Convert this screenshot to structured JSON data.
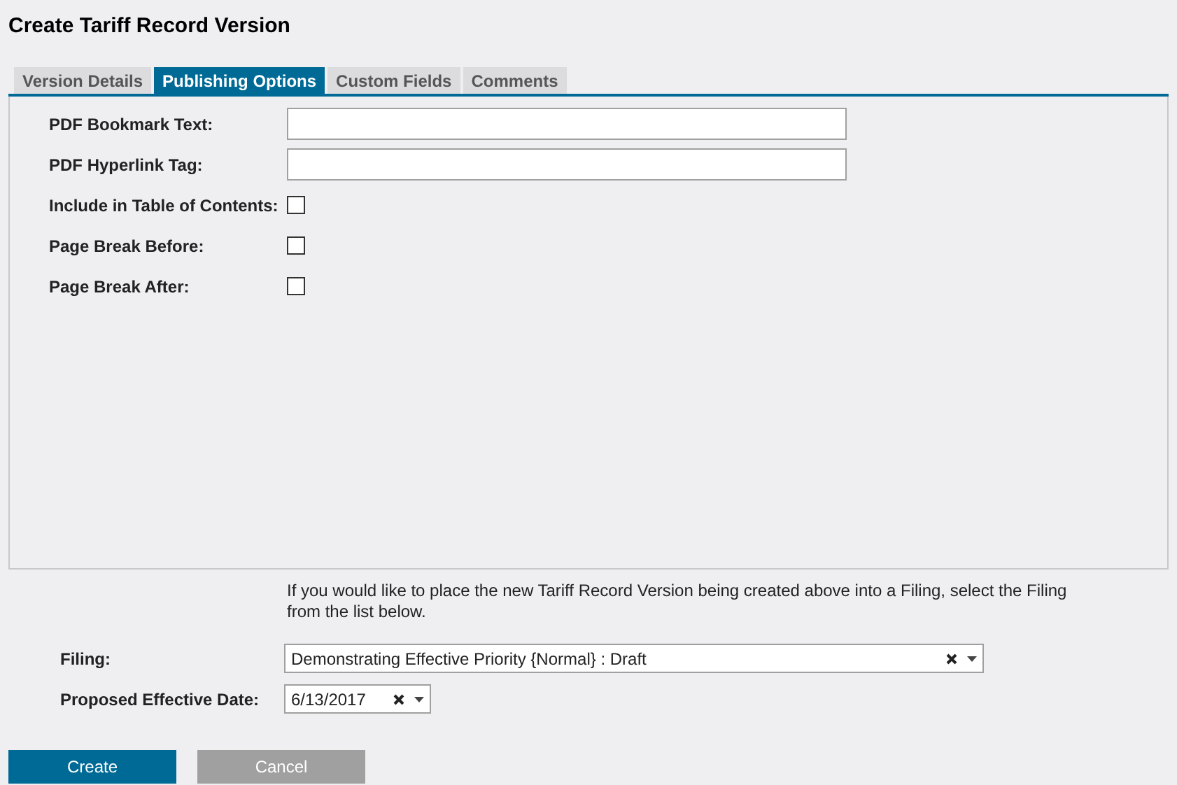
{
  "title": "Create Tariff Record Version",
  "tabs": [
    {
      "label": "Version Details",
      "selected": false
    },
    {
      "label": "Publishing Options",
      "selected": true
    },
    {
      "label": "Custom Fields",
      "selected": false
    },
    {
      "label": "Comments",
      "selected": false
    }
  ],
  "fields": [
    {
      "kind": "text",
      "label": "PDF Bookmark Text:"
    },
    {
      "kind": "text",
      "label": "PDF Hyperlink Tag:"
    },
    {
      "kind": "checkbox",
      "label": "Include in Table of Contents:",
      "checked": false
    },
    {
      "kind": "checkbox",
      "label": "Page Break Before:",
      "checked": false
    },
    {
      "kind": "checkbox",
      "label": "Page Break After:",
      "checked": false
    }
  ],
  "filing_note": "If you would like to place the new Tariff Record Version being created above into a Filing, select the Filing from the list below.",
  "filing": {
    "label": "Filing:",
    "value": "Demonstrating Effective Priority {Normal} : Draft"
  },
  "effective_date": {
    "label": "Proposed Effective Date:",
    "value": "6/13/2017"
  },
  "buttons": [
    {
      "label": "Create",
      "kind": "primary"
    },
    {
      "label": "Cancel",
      "kind": "secondary"
    }
  ]
}
